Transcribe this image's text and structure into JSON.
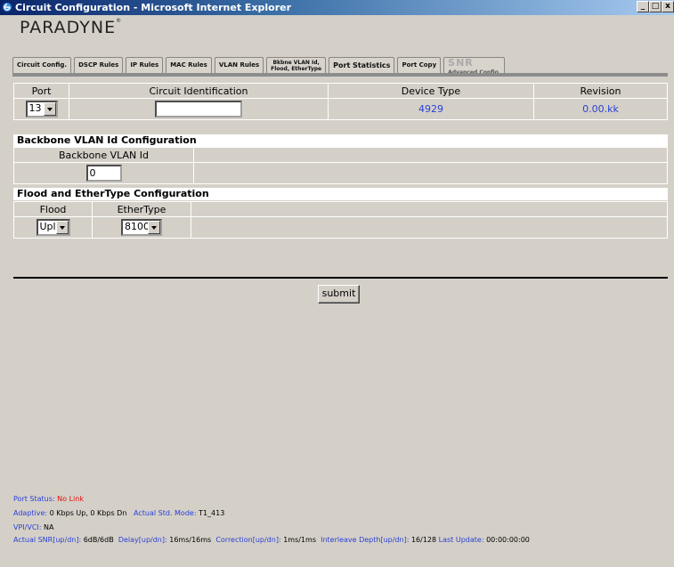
{
  "window": {
    "title": "Circuit Configuration - Microsoft Internet Explorer"
  },
  "brand": {
    "logo_text": "PARADYNE"
  },
  "tabs": [
    {
      "label": "Circuit Config."
    },
    {
      "label": "DSCP Rules"
    },
    {
      "label": "IP Rules"
    },
    {
      "label": "MAC Rules"
    },
    {
      "label": "VLAN Rules"
    },
    {
      "label_line1": "Bkbne VLAN Id,",
      "label_line2": "Flood, EtherType"
    },
    {
      "label": "Port Statistics"
    },
    {
      "label": "Port Copy"
    },
    {
      "label_top": "SNR",
      "label_bottom": "Advanced Config."
    }
  ],
  "port_table": {
    "headers": [
      "Port",
      "Circuit Identification",
      "Device Type",
      "Revision"
    ],
    "port_value": "13",
    "circuit_id_value": "",
    "device_type": "4929",
    "revision": "0.00.kk"
  },
  "backbone": {
    "section_title": "Backbone VLAN Id Configuration",
    "column_header": "Backbone VLAN Id",
    "value": "0"
  },
  "flood": {
    "section_title": "Flood and EtherType Configuration",
    "flood_header": "Flood",
    "ethertype_header": "EtherType",
    "flood_value": "Upl",
    "ethertype_value": "8100"
  },
  "submit_label": "submit",
  "status": {
    "port_status_label": "Port Status:",
    "port_status_value": "No Link",
    "adaptive_label": "Adaptive:",
    "adaptive_value": "0 Kbps Up, 0 Kbps Dn",
    "std_mode_label": "Actual Std. Mode:",
    "std_mode_value": "T1_413",
    "vpivci_label": "VPI/VCI:",
    "vpivci_value": "NA",
    "snr_label": "Actual SNR[up/dn]:",
    "snr_value": "6dB/6dB",
    "delay_label": "Delay[up/dn]:",
    "delay_value": "16ms/16ms",
    "correction_label": "Correction[up/dn]:",
    "correction_value": "1ms/1ms",
    "interleave_label": "Interleave Depth[up/dn]:",
    "interleave_value": "16/128",
    "last_update_label": "Last Update:",
    "last_update_value": "00:00:00:00"
  },
  "colors": {
    "link_blue": "#2a3fd6",
    "alert_red": "#e01010",
    "titlebar": "#0a246a"
  }
}
